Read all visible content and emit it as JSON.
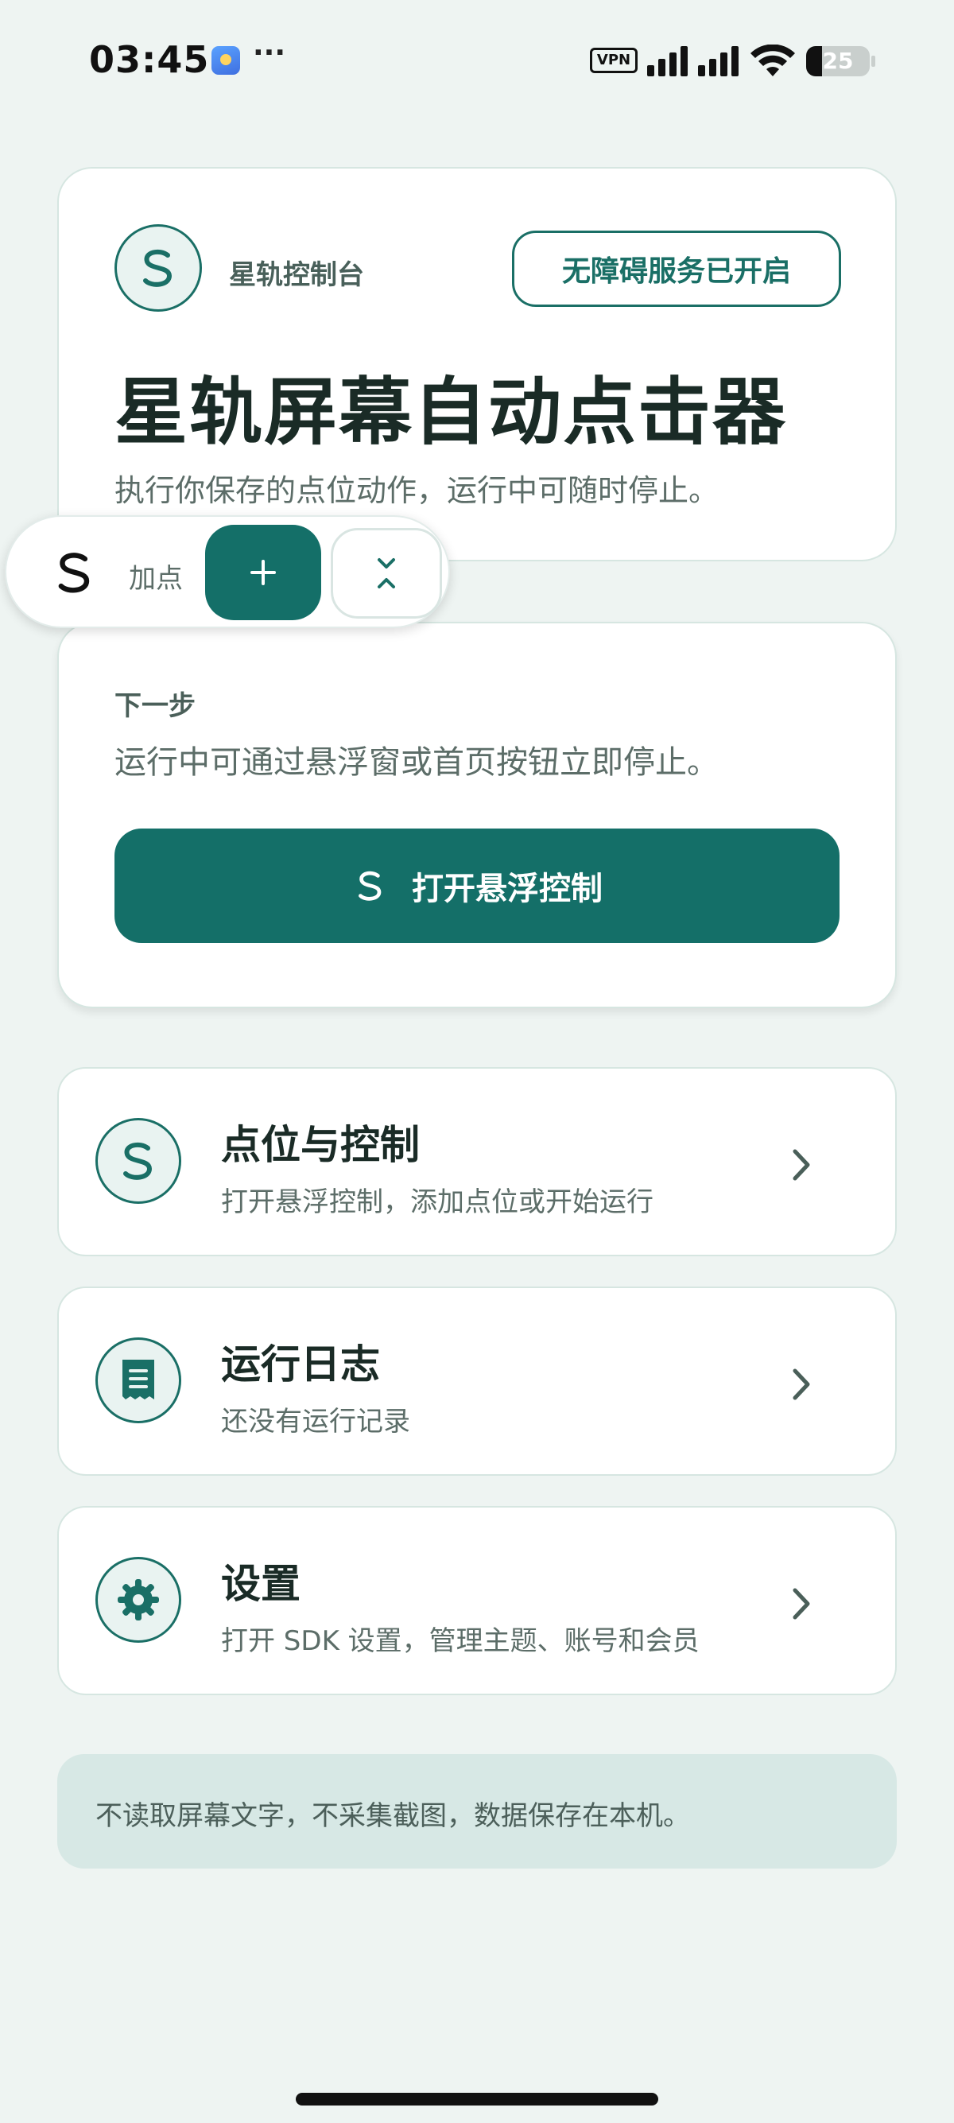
{
  "status_bar": {
    "time": "03:45",
    "more": "···",
    "vpn": "VPN",
    "battery": "25",
    "battery_level": 0.25
  },
  "hero": {
    "brand": "星轨控制台",
    "status_pill": "无障碍服务已开启",
    "title": "星轨屏幕自动点击器",
    "description": "执行你保存的点位动作，运行中可随时停止。"
  },
  "float_bar": {
    "label": "加点",
    "add_symbol": "+"
  },
  "next_step": {
    "label": "下一步",
    "description": "运行中可通过悬浮窗或首页按钮立即停止。",
    "button": "打开悬浮控制"
  },
  "rows": [
    {
      "title": "点位与控制",
      "subtitle": "打开悬浮控制，添加点位或开始运行",
      "icon": "orbit-logo-icon"
    },
    {
      "title": "运行日志",
      "subtitle": "还没有运行记录",
      "icon": "receipt-icon"
    },
    {
      "title": "设置",
      "subtitle": "打开 SDK 设置，管理主题、账号和会员",
      "icon": "gear-icon"
    }
  ],
  "notice": "不读取屏幕文字，不采集截图，数据保存在本机。",
  "colors": {
    "accent": "#146f68",
    "background": "#eef4f2",
    "notice_bg": "#d7e8e5"
  }
}
